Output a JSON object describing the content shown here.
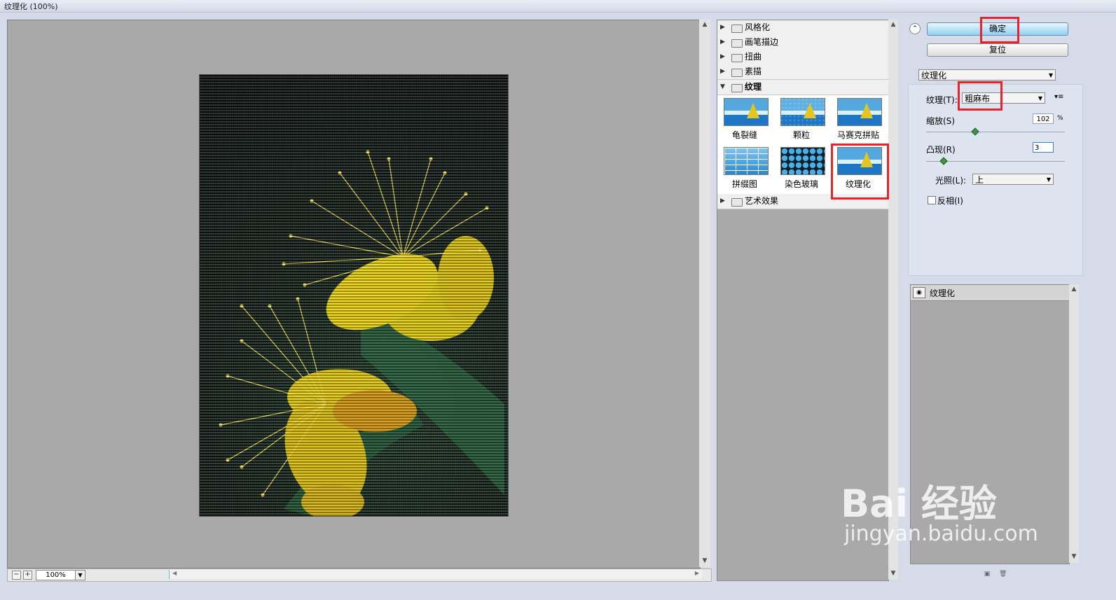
{
  "window": {
    "title": "纹理化 (100%)"
  },
  "preview": {
    "zoom": "100%"
  },
  "filter_categories": [
    {
      "label": "风格化",
      "state": "collapsed"
    },
    {
      "label": "画笔描边",
      "state": "collapsed"
    },
    {
      "label": "扭曲",
      "state": "collapsed"
    },
    {
      "label": "素描",
      "state": "collapsed"
    },
    {
      "label": "纹理",
      "state": "expanded"
    },
    {
      "label": "艺术效果",
      "state": "collapsed"
    }
  ],
  "texture_filters": [
    {
      "label": "龟裂缝"
    },
    {
      "label": "颗粒"
    },
    {
      "label": "马赛克拼贴"
    },
    {
      "label": "拼缀图"
    },
    {
      "label": "染色玻璃"
    },
    {
      "label": "纹理化",
      "selected": true
    }
  ],
  "buttons": {
    "ok": "确定",
    "reset": "复位"
  },
  "filter_select": {
    "value": "纹理化"
  },
  "settings": {
    "texture_label": "纹理(T):",
    "texture_value": "粗麻布",
    "scale_label": "缩放(S)",
    "scale_value": "102",
    "scale_unit": "%",
    "relief_label": "凸现(R)",
    "relief_value": "3",
    "light_label": "光照(L):",
    "light_value": "上",
    "invert_label": "反相(I)",
    "invert_checked": false
  },
  "layers": [
    {
      "name": "纹理化",
      "visible": true
    }
  ],
  "watermark": {
    "brand": "Bai 经验",
    "url": "jingyan.baidu.com"
  },
  "colors": {
    "highlight": "#e8232a",
    "ok_button": "#90d1f3",
    "canvas_gray": "#a9a9a9"
  }
}
